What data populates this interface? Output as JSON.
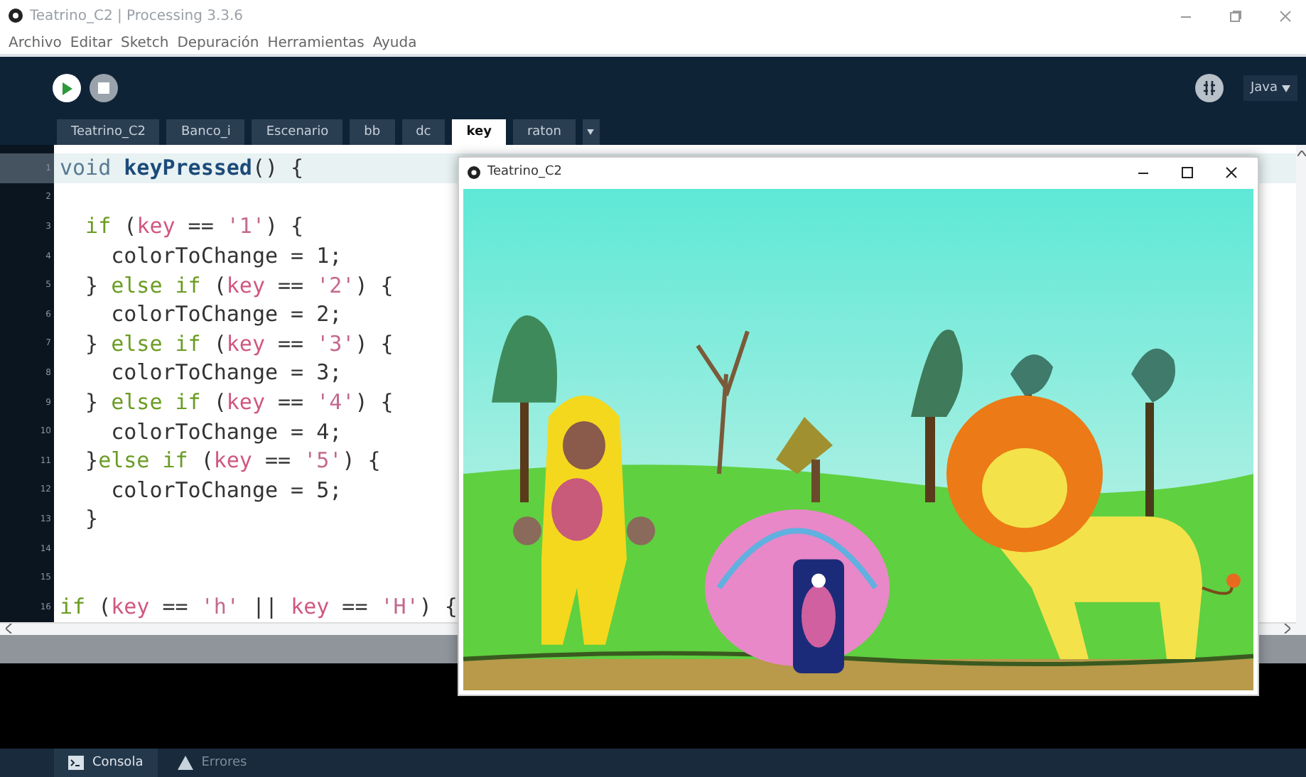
{
  "window": {
    "title": "Teatrino_C2 | Processing 3.3.6"
  },
  "menu": [
    "Archivo",
    "Editar",
    "Sketch",
    "Depuración",
    "Herramientas",
    "Ayuda"
  ],
  "toolbar": {
    "mode": "Java"
  },
  "tabs": [
    {
      "label": "Teatrino_C2",
      "selected": false
    },
    {
      "label": "Banco_i",
      "selected": false
    },
    {
      "label": "Escenario",
      "selected": false
    },
    {
      "label": "bb",
      "selected": false
    },
    {
      "label": "dc",
      "selected": false
    },
    {
      "label": "key",
      "selected": true
    },
    {
      "label": "raton",
      "selected": false
    }
  ],
  "editor": {
    "lines": [
      {
        "number": "1",
        "highlighted": true,
        "tokens": [
          {
            "kind": "type",
            "text": "void "
          },
          {
            "kind": "function",
            "text": "keyPressed"
          },
          {
            "kind": "plain",
            "text": "() {"
          }
        ]
      },
      {
        "number": "2",
        "highlighted": false
      },
      {
        "number": "3",
        "highlighted": false,
        "tokens": [
          {
            "kind": "keyword",
            "text": "  if"
          },
          {
            "kind": "plain",
            "text": " ("
          },
          {
            "kind": "variable",
            "text": "key"
          },
          {
            "kind": "plain",
            "text": " == "
          },
          {
            "kind": "string",
            "text": "'1'"
          },
          {
            "kind": "plain",
            "text": ") {"
          }
        ]
      },
      {
        "number": "4",
        "highlighted": false,
        "tokens": [
          {
            "kind": "plain",
            "text": "    colorToChange = 1;"
          }
        ]
      },
      {
        "number": "5",
        "highlighted": false,
        "tokens": [
          {
            "kind": "plain",
            "text": "  } "
          },
          {
            "kind": "keyword",
            "text": "else if"
          },
          {
            "kind": "plain",
            "text": " ("
          },
          {
            "kind": "variable",
            "text": "key"
          },
          {
            "kind": "plain",
            "text": " == "
          },
          {
            "kind": "string",
            "text": "'2'"
          },
          {
            "kind": "plain",
            "text": ") {"
          }
        ]
      },
      {
        "number": "6",
        "highlighted": false,
        "tokens": [
          {
            "kind": "plain",
            "text": "    colorToChange = 2;"
          }
        ]
      },
      {
        "number": "7",
        "highlighted": false,
        "tokens": [
          {
            "kind": "plain",
            "text": "  } "
          },
          {
            "kind": "keyword",
            "text": "else if"
          },
          {
            "kind": "plain",
            "text": " ("
          },
          {
            "kind": "variable",
            "text": "key"
          },
          {
            "kind": "plain",
            "text": " == "
          },
          {
            "kind": "string",
            "text": "'3'"
          },
          {
            "kind": "plain",
            "text": ") {"
          }
        ]
      },
      {
        "number": "8",
        "highlighted": false,
        "tokens": [
          {
            "kind": "plain",
            "text": "    colorToChange = 3;"
          }
        ]
      },
      {
        "number": "9",
        "highlighted": false,
        "tokens": [
          {
            "kind": "plain",
            "text": "  } "
          },
          {
            "kind": "keyword",
            "text": "else if"
          },
          {
            "kind": "plain",
            "text": " ("
          },
          {
            "kind": "variable",
            "text": "key"
          },
          {
            "kind": "plain",
            "text": " == "
          },
          {
            "kind": "string",
            "text": "'4'"
          },
          {
            "kind": "plain",
            "text": ") {"
          }
        ]
      },
      {
        "number": "10",
        "highlighted": false,
        "tokens": [
          {
            "kind": "plain",
            "text": "    colorToChange = 4;"
          }
        ]
      },
      {
        "number": "11",
        "highlighted": false,
        "tokens": [
          {
            "kind": "plain",
            "text": "  }"
          },
          {
            "kind": "keyword",
            "text": "else if"
          },
          {
            "kind": "plain",
            "text": " ("
          },
          {
            "kind": "variable",
            "text": "key"
          },
          {
            "kind": "plain",
            "text": " == "
          },
          {
            "kind": "string",
            "text": "'5'"
          },
          {
            "kind": "plain",
            "text": ") {"
          }
        ]
      },
      {
        "number": "12",
        "highlighted": false,
        "tokens": [
          {
            "kind": "plain",
            "text": "    colorToChange = 5;"
          }
        ]
      },
      {
        "number": "13",
        "highlighted": false,
        "tokens": [
          {
            "kind": "plain",
            "text": "  }"
          }
        ]
      },
      {
        "number": "14",
        "highlighted": false
      },
      {
        "number": "15",
        "highlighted": false
      },
      {
        "number": "16",
        "highlighted": false,
        "tokens": [
          {
            "kind": "keyword",
            "text": "if"
          },
          {
            "kind": "plain",
            "text": " ("
          },
          {
            "kind": "variable",
            "text": "key"
          },
          {
            "kind": "plain",
            "text": " == "
          },
          {
            "kind": "string",
            "text": "'h'"
          },
          {
            "kind": "plain",
            "text": " || "
          },
          {
            "kind": "variable",
            "text": "key"
          },
          {
            "kind": "plain",
            "text": " == "
          },
          {
            "kind": "string",
            "text": "'H'"
          },
          {
            "kind": "plain",
            "text": ") {"
          }
        ]
      }
    ]
  },
  "sketch_window": {
    "title": "Teatrino_C2"
  },
  "console_tabs": [
    {
      "label": "Consola",
      "kind": "console",
      "selected": true
    },
    {
      "label": "Errores",
      "kind": "errors",
      "selected": false
    }
  ]
}
